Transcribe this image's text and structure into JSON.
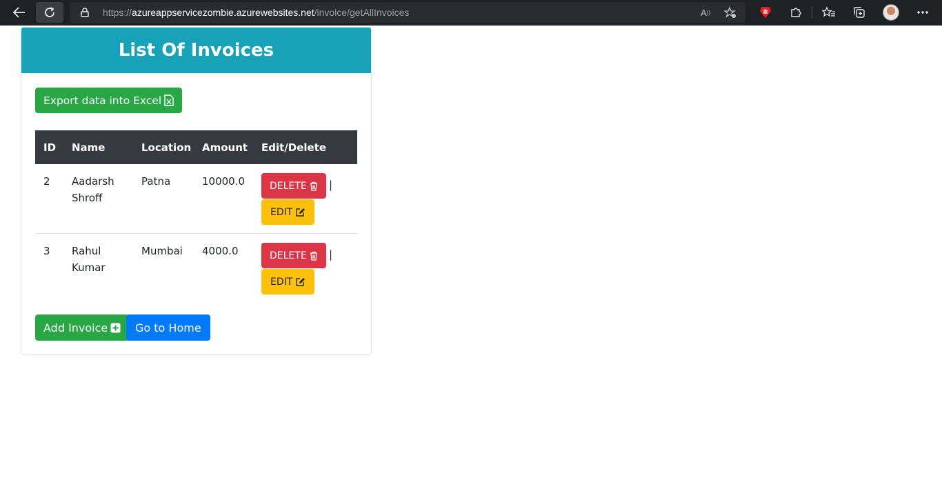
{
  "browser": {
    "url_scheme": "https://",
    "url_host": "azureappservicezombie.azurewebsites.net",
    "url_path": "/invoice/getAllInvoices",
    "read_aloud_label": "A"
  },
  "page": {
    "title": "List Of Invoices",
    "export_label": "Export data into Excel",
    "table": {
      "headers": [
        "ID",
        "Name",
        "Location",
        "Amount",
        "Edit/Delete"
      ],
      "rows": [
        {
          "id": "2",
          "name_line1": "Aadarsh",
          "name_line2": "Shroff",
          "location": "Patna",
          "amount": "10000.0"
        },
        {
          "id": "3",
          "name_line1": "Rahul",
          "name_line2": "Kumar",
          "location": "Mumbai",
          "amount": "4000.0"
        }
      ],
      "delete_label": "DELETE",
      "edit_label": "EDIT",
      "separator": "|"
    },
    "add_invoice_label": "Add Invoice",
    "home_label": "Go to Home"
  },
  "colors": {
    "header_bg": "#17a2b8",
    "success": "#28a745",
    "primary": "#007bff",
    "danger": "#dc3545",
    "warning": "#ffc107",
    "table_head": "#343a40"
  },
  "icons": [
    "back-arrow-icon",
    "refresh-icon",
    "lock-icon",
    "read-aloud-icon",
    "add-favorite-icon",
    "extension-shield-icon",
    "extensions-puzzle-icon",
    "favorites-icon",
    "collections-icon",
    "more-icon",
    "excel-file-icon",
    "trash-icon",
    "edit-square-icon",
    "plus-square-icon"
  ]
}
